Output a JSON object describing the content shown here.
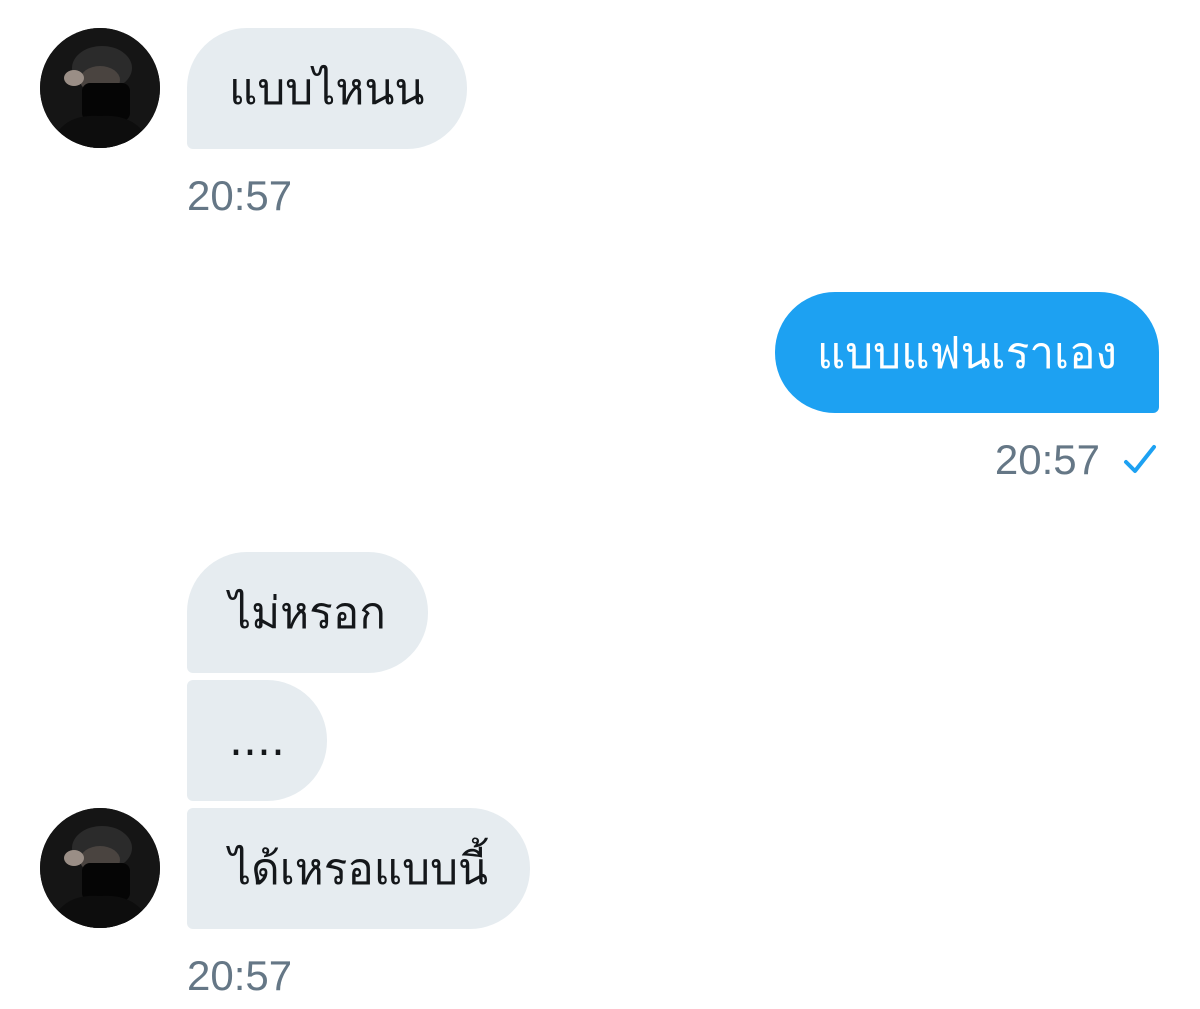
{
  "conversation": {
    "messages": [
      {
        "sender": "contact",
        "text": "แบบไหนน",
        "time": "20:57",
        "avatar": "contact-avatar"
      },
      {
        "sender": "me",
        "text": "แบบแฟนเราเอง",
        "time": "20:57",
        "status": "sent-check-icon"
      },
      {
        "sender": "contact",
        "text": "ไม่หรอก"
      },
      {
        "sender": "contact",
        "text": "...."
      },
      {
        "sender": "contact",
        "text": "ได้เหรอแบบนี้",
        "time": "20:57",
        "avatar": "contact-avatar"
      }
    ]
  },
  "colors": {
    "incoming_bubble": "#e6ecf0",
    "outgoing_bubble": "#1da1f2",
    "timestamp": "#657786",
    "check": "#1da1f2"
  }
}
